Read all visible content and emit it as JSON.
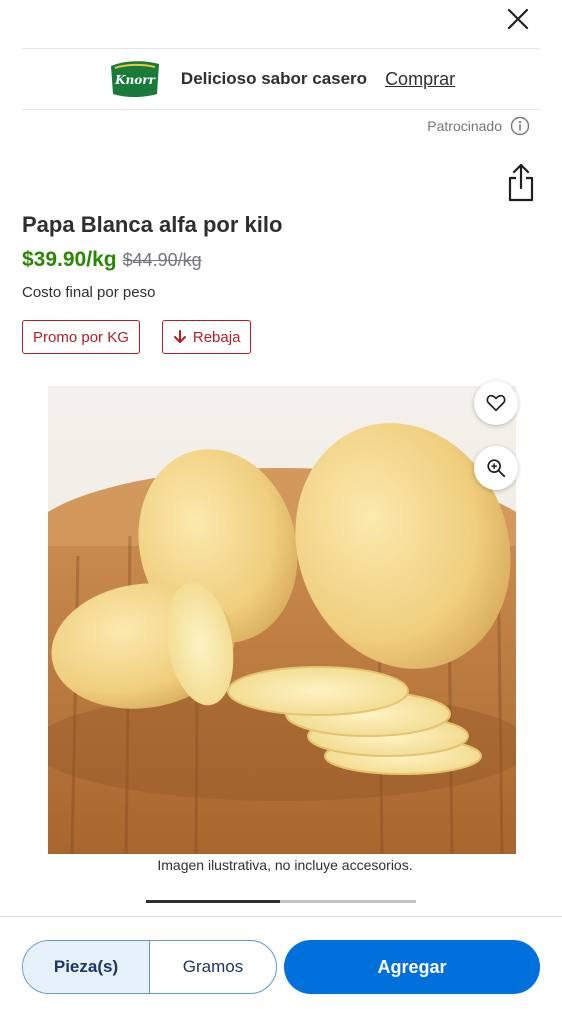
{
  "header": {
    "close_icon": "close-icon"
  },
  "banner": {
    "brand_logo": "Knorr",
    "text": "Delicioso sabor casero",
    "link": "Comprar",
    "sponsored_label": "Patrocinado",
    "info_icon": "info-icon",
    "colors": {
      "logo_green": "#1a7a3a"
    }
  },
  "product": {
    "title": "Papa Blanca alfa por kilo",
    "price": "$39.90/kg",
    "old_price": "$44.90/kg",
    "price_note": "Costo final por peso",
    "tags": [
      {
        "label": "Promo por KG",
        "icon": ""
      },
      {
        "label": "Rebaja",
        "icon": "arrow-down-icon"
      }
    ],
    "image_caption": "Imagen ilustrativa, no incluye accesorios.",
    "image_alt": "potatoes on wooden board",
    "carousel": {
      "current": 1,
      "total": 2
    },
    "colors": {
      "price": "#2a8703",
      "tag": "#b21e26"
    }
  },
  "actions": {
    "share_icon": "share-icon",
    "favorite_icon": "heart-icon",
    "zoom_icon": "zoom-in-icon"
  },
  "footer": {
    "units": [
      {
        "label": "Pieza(s)",
        "selected": true
      },
      {
        "label": "Gramos",
        "selected": false
      }
    ],
    "add_label": "Agregar",
    "colors": {
      "primary": "#0071dc"
    }
  }
}
